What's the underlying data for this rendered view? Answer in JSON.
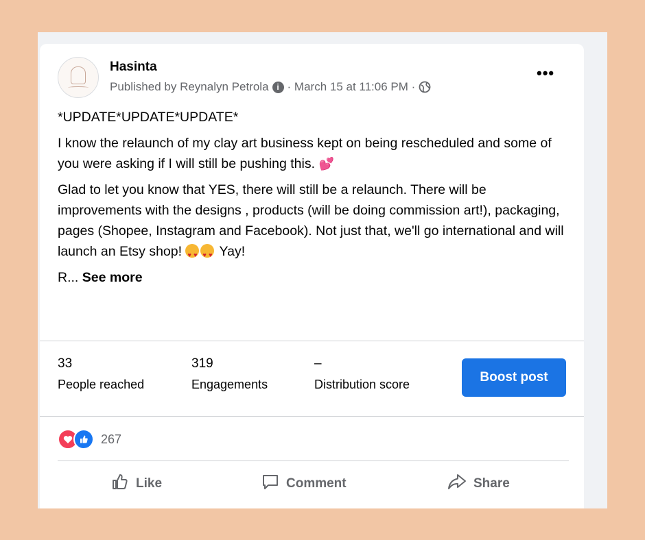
{
  "post": {
    "page_name": "Hasinta",
    "published_by": "Published by Reynalyn Petrola",
    "info_glyph": "i",
    "date": "· March 15 at 11:06 PM ·",
    "more_glyph": "•••",
    "paragraphs": {
      "p1": "*UPDATE*UPDATE*UPDATE*",
      "p2": "I know the relaunch of my clay art business kept on being rescheduled and some of you were asking if I will still be pushing this.",
      "p3": "Glad to let you know that YES, there will still be a relaunch. There will be improvements with the designs , products (will be doing commission art!), packaging, pages (Shopee, Instagram and Facebook). Not just that, we'll go international and will launch an Etsy shop!",
      "p3_tail": "Yay!",
      "p4_prefix": "R...",
      "see_more": "See more"
    },
    "emoji": {
      "two_hearts": "💕"
    }
  },
  "insights": {
    "people_reached": {
      "value": "33",
      "label": "People reached"
    },
    "engagements": {
      "value": "319",
      "label": "Engagements"
    },
    "distribution": {
      "value": "–",
      "label": "Distribution score"
    },
    "boost_label": "Boost post"
  },
  "reactions": {
    "count": "267",
    "types": [
      "love-icon",
      "like-icon"
    ]
  },
  "actions": {
    "like": "Like",
    "comment": "Comment",
    "share": "Share"
  },
  "colors": {
    "background": "#f2c6a5",
    "boost": "#1b74e4",
    "love": "#f33e58",
    "like": "#1877f2"
  }
}
